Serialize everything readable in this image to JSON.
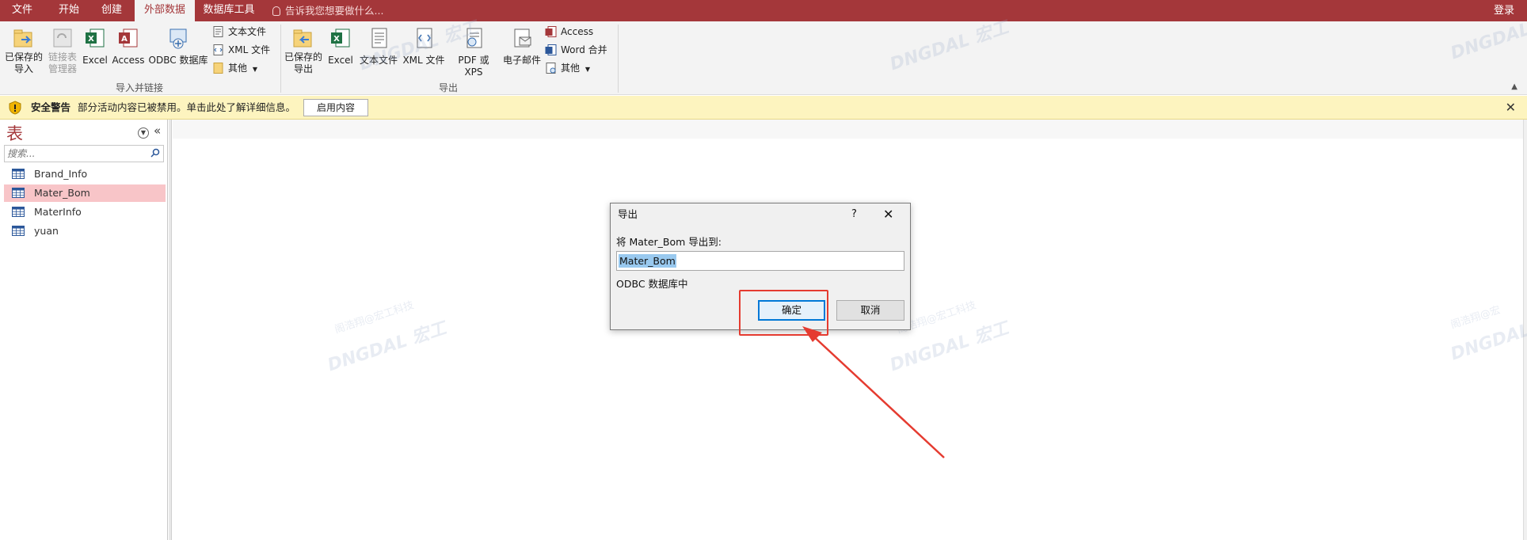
{
  "tabs": [
    "文件",
    "开始",
    "创建",
    "外部数据",
    "数据库工具"
  ],
  "active_tab": "外部数据",
  "tell_me": "告诉我您想要做什么...",
  "account": "登录",
  "ribbon": {
    "import_group": {
      "label": "导入并链接",
      "saved_imports": "已保存的\n导入",
      "linked_table_manager": "链接表\n管理器",
      "excel": "Excel",
      "access": "Access",
      "odbc": "ODBC 数据库",
      "text_file": "文本文件",
      "xml_file": "XML 文件",
      "more": "其他"
    },
    "export_group": {
      "label": "导出",
      "saved_exports": "已保存的\n导出",
      "excel": "Excel",
      "text_file": "文本文件",
      "xml_file": "XML 文件",
      "pdf_xps": "PDF 或 XPS",
      "email": "电子邮件",
      "access": "Access",
      "word_merge": "Word 合并",
      "more": "其他"
    }
  },
  "security_bar": {
    "title": "安全警告",
    "message": "部分活动内容已被禁用。单击此处了解详细信息。",
    "button": "启用内容"
  },
  "nav_pane": {
    "title": "表",
    "search_placeholder": "搜索...",
    "tables": [
      "Brand_Info",
      "Mater_Bom",
      "MaterInfo",
      "yuan"
    ],
    "selected": "Mater_Bom"
  },
  "dialog": {
    "title": "导出",
    "help": "?",
    "prompt": "将 Mater_Bom 导出到:",
    "input_value": "Mater_Bom",
    "target": "ODBC 数据库中",
    "ok": "确定",
    "cancel": "取消"
  },
  "colors": {
    "accent": "#a4373a",
    "security_bar": "#fdf4bf",
    "selected_row": "#f8c5c8",
    "annotation": "#e53b30"
  }
}
